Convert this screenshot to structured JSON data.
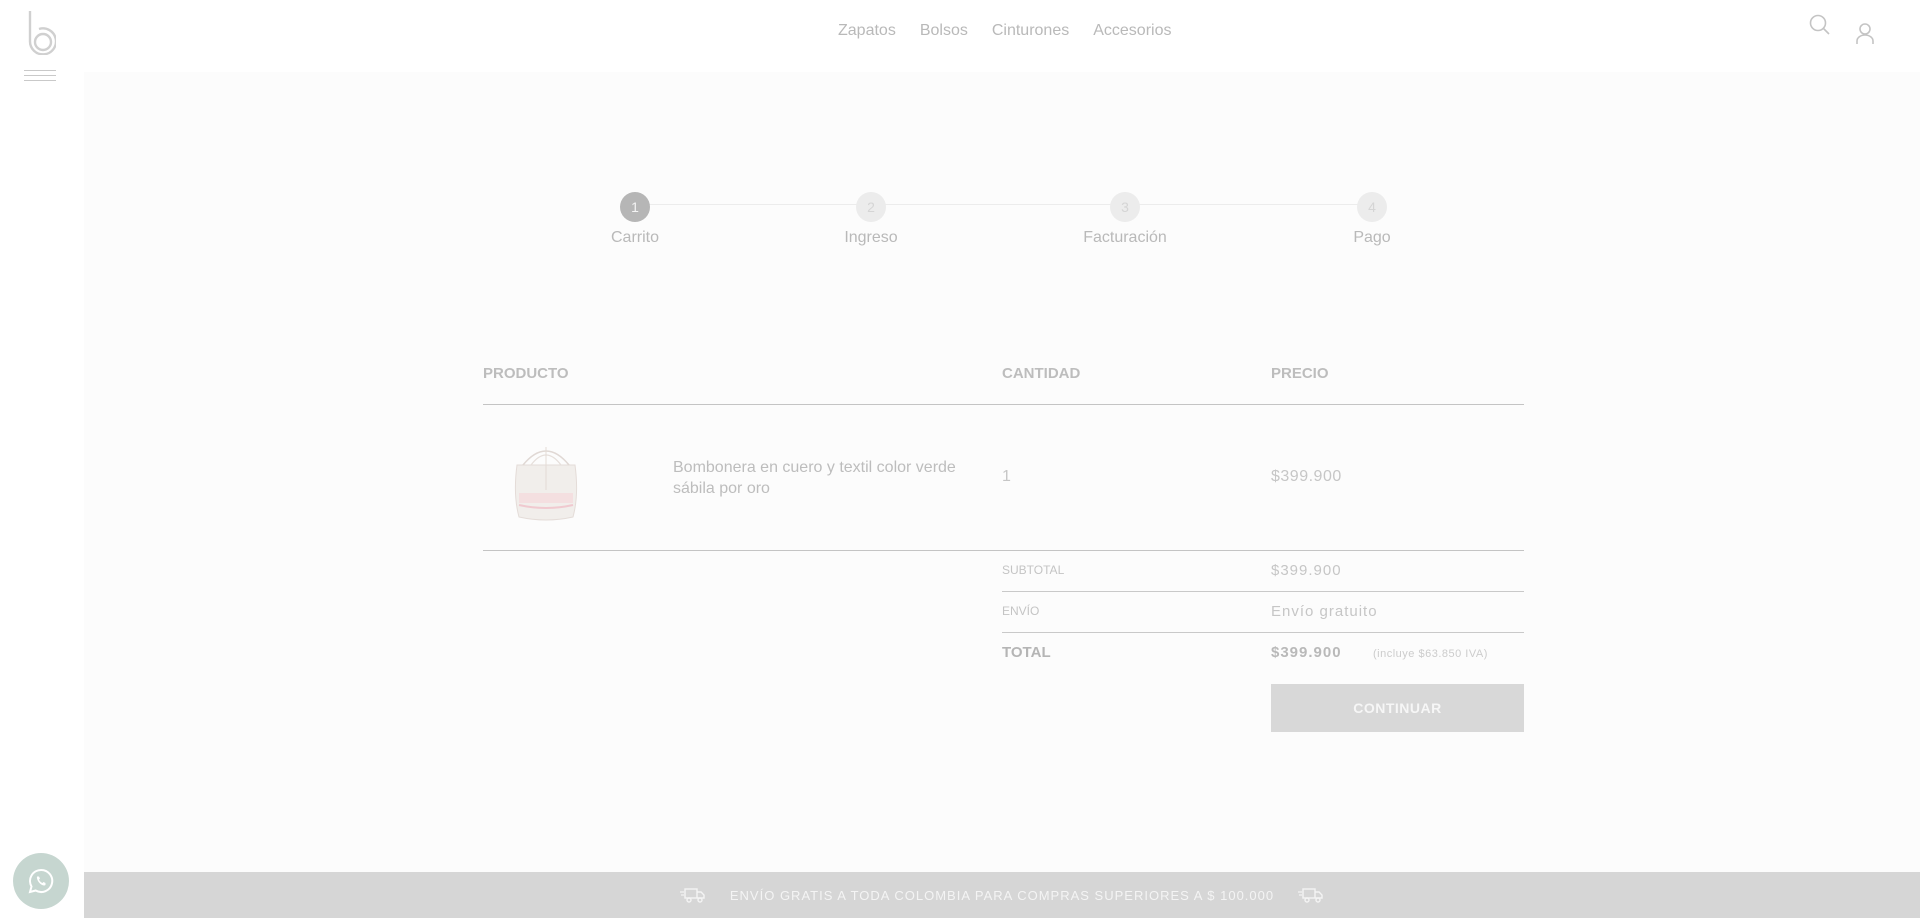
{
  "nav": {
    "items": [
      "Zapatos",
      "Bolsos",
      "Cinturones",
      "Accesorios"
    ]
  },
  "icons": {
    "logo": "brand-logo",
    "menu": "hamburger-icon",
    "search": "search-icon",
    "user": "user-icon",
    "whatsapp": "whatsapp-icon",
    "shipping": "truck-icon"
  },
  "stepper": {
    "steps": [
      {
        "number": "1",
        "label": "Carrito",
        "active": true
      },
      {
        "number": "2",
        "label": "Ingreso",
        "active": false
      },
      {
        "number": "3",
        "label": "Facturación",
        "active": false
      },
      {
        "number": "4",
        "label": "Pago",
        "active": false
      }
    ]
  },
  "cart": {
    "headers": {
      "product": "PRODUCTO",
      "quantity": "CANTIDAD",
      "price": "PRECIO"
    },
    "items": [
      {
        "name": "Bombonera en cuero y textil color verde sábila por oro",
        "quantity": "1",
        "price": "$399.900"
      }
    ],
    "summary": {
      "subtotal_label": "SUBTOTAL",
      "subtotal_value": "$399.900",
      "shipping_label": "ENVÍO",
      "shipping_value": "Envío gratuito",
      "total_label": "TOTAL",
      "total_value": "$399.900",
      "total_note": "(incluye $63.850 IVA)"
    },
    "continue_label": "CONTINUAR"
  },
  "banner": {
    "text": "ENVÍO GRATIS A TODA COLOMBIA PARA COMPRAS SUPERIORES A $ 100.000"
  },
  "colors": {
    "step_active": "#b6b6b6",
    "button_bg": "#d8d8d8",
    "banner_bg": "#d6d6d6",
    "whatsapp_bg": "#c6d6d0"
  }
}
